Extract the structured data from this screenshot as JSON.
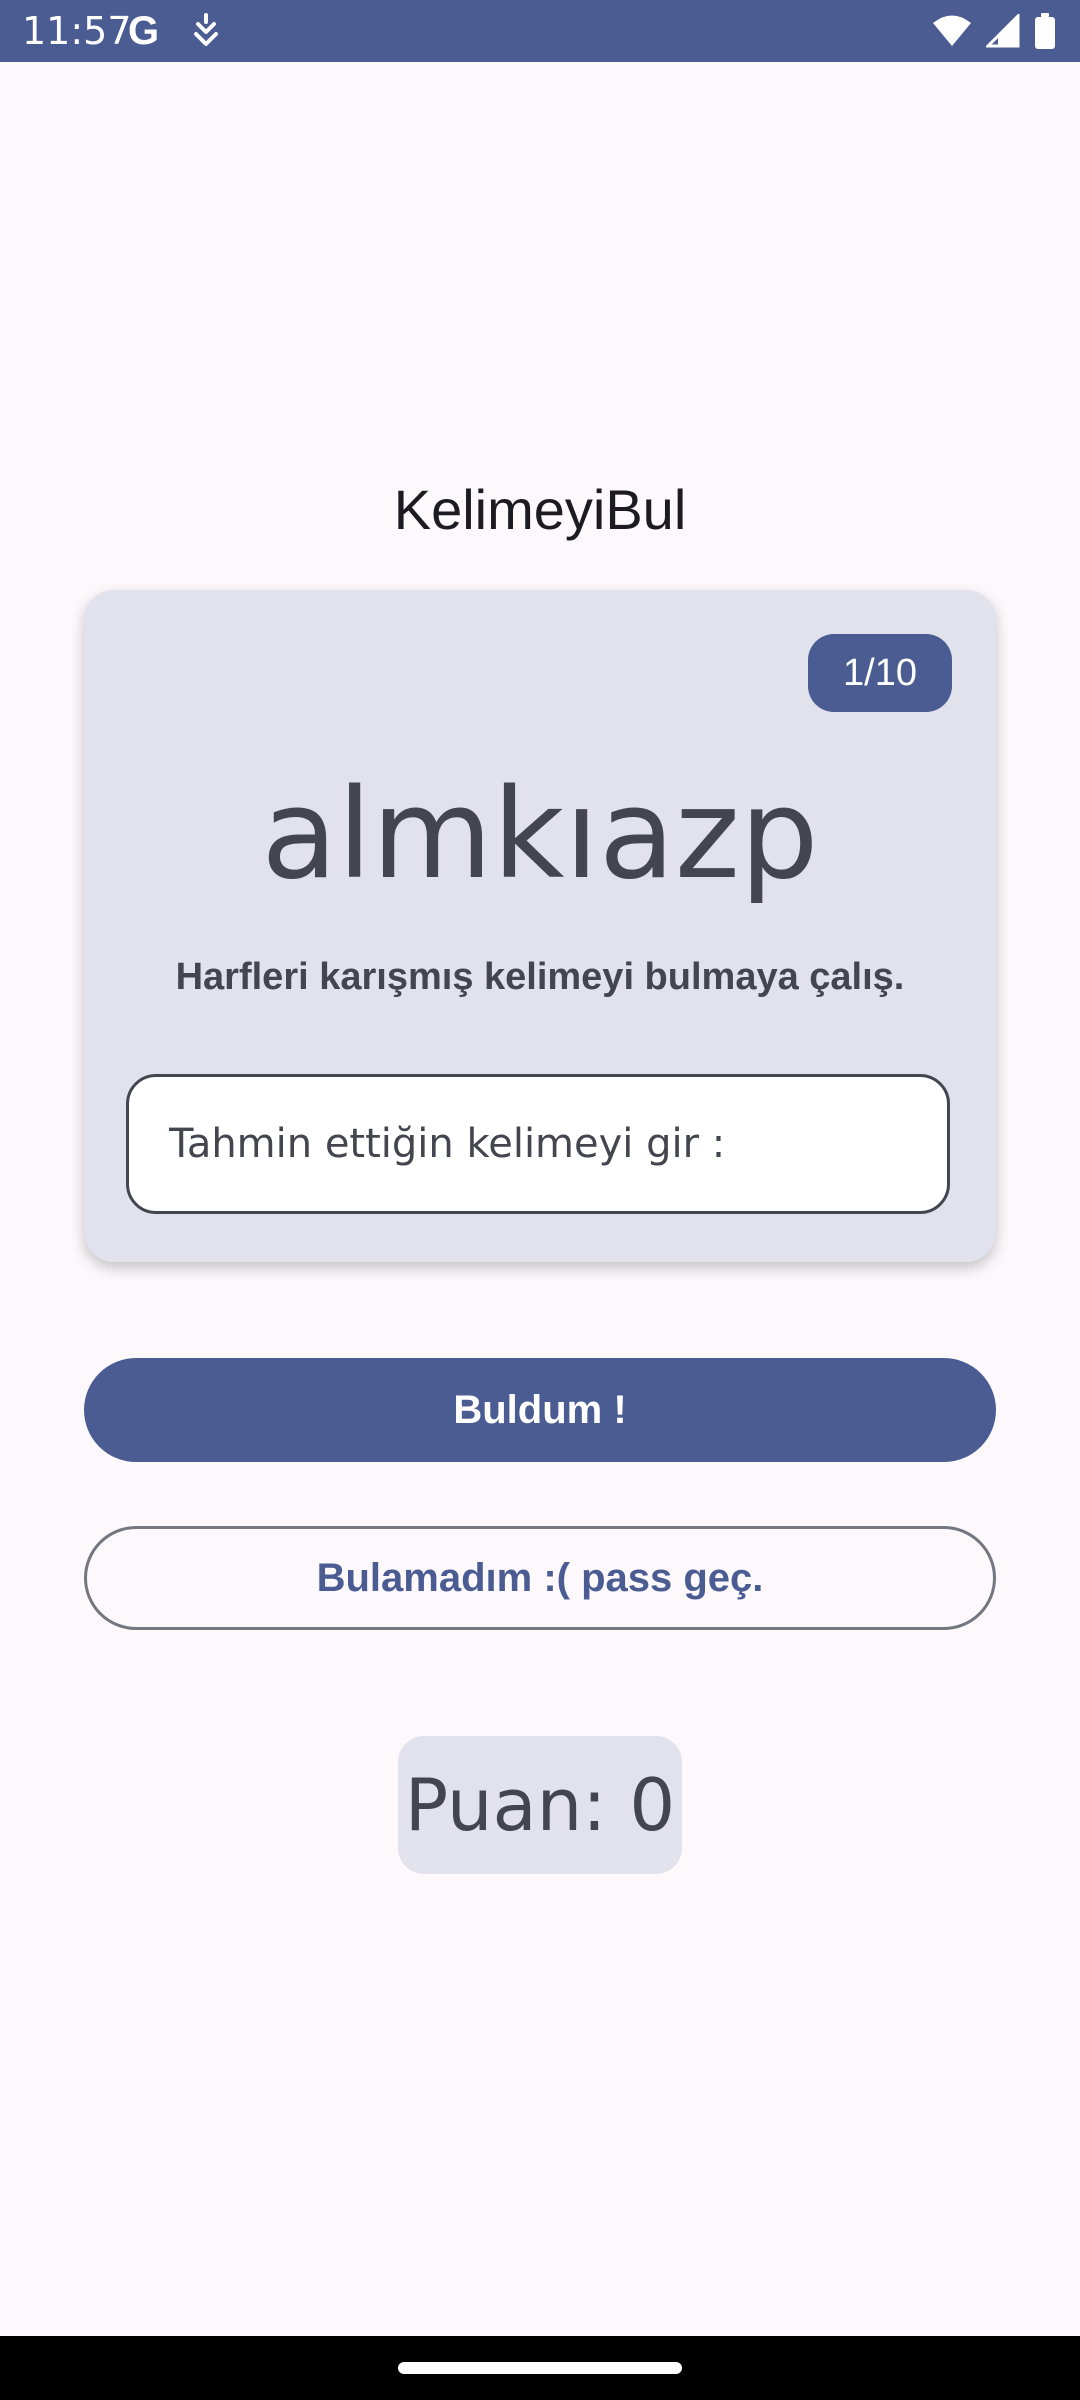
{
  "status_bar": {
    "time": "11:57",
    "google_glyph": "G",
    "icons": [
      "google-icon",
      "notification-icon",
      "wifi-icon",
      "signal-icon",
      "battery-icon"
    ]
  },
  "app": {
    "title": "KelimeyiBul"
  },
  "card": {
    "counter": "1/10",
    "scrambled_word": "almkıazp",
    "instructions": "Harfleri karışmış kelimeyi bulmaya çalış.",
    "guess_input": {
      "placeholder": "Tahmin ettiğin kelimeyi gir :",
      "value": ""
    }
  },
  "buttons": {
    "submit_label": "Buldum !",
    "skip_label": "Bulamadım :( pass geç."
  },
  "score": {
    "text": "Puan: 0"
  },
  "colors": {
    "primary": "#4a5c92",
    "card_background": "#e1e2ec",
    "page_background": "#fcf8fc",
    "text": "#44464f"
  }
}
